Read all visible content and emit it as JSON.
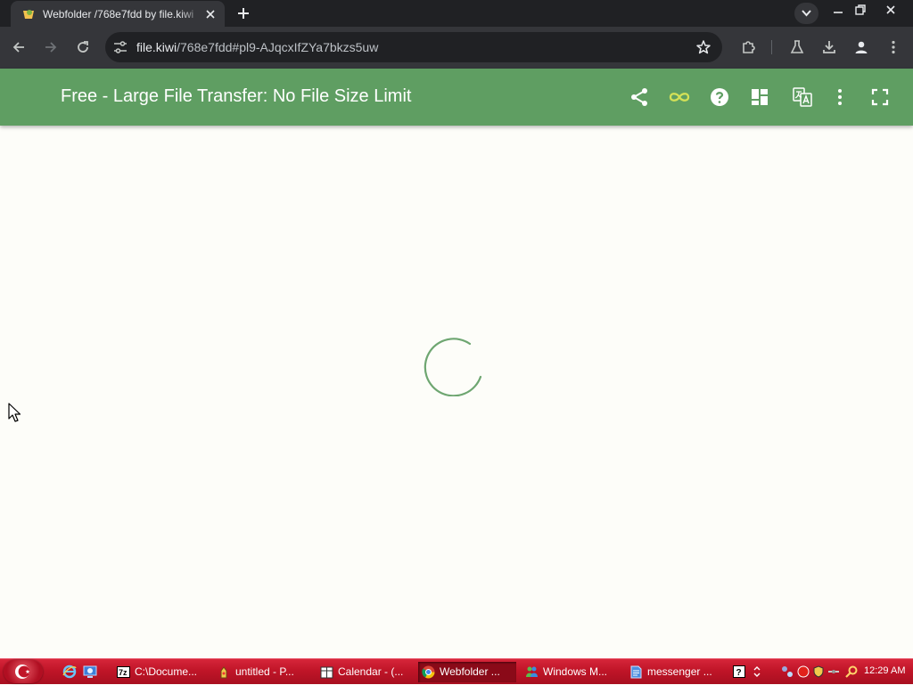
{
  "browser": {
    "tab": {
      "title": "Webfolder /768e7fdd by file.kiwi",
      "favicon": "kiwi-favicon-icon"
    },
    "url": {
      "host": "file.kiwi",
      "path": "/768e7fdd#pl9-AJqcxIfZYa7bkzs5uw"
    },
    "colors": {
      "tabstrip": "#202124",
      "toolbar": "#35363a"
    }
  },
  "app": {
    "title": "Free - Large File Transfer: No File Size Limit",
    "header_color": "#5f9e62",
    "infinity_color": "#d4e157",
    "actions": [
      "share-icon",
      "infinity-icon",
      "help-icon",
      "dashboard-icon",
      "translate-icon",
      "more-vert-icon",
      "fullscreen-icon"
    ],
    "loading": true
  },
  "taskbar": {
    "color": "#c01528",
    "tasks": [
      {
        "label": "C:\\Docume...",
        "icon": "7zip-icon"
      },
      {
        "label": "untitled - P...",
        "icon": "paint-icon"
      },
      {
        "label": "Calendar - (...",
        "icon": "calendar-icon"
      },
      {
        "label": "Webfolder ...",
        "icon": "chrome-icon",
        "active": true
      },
      {
        "label": "Windows M...",
        "icon": "messenger-icon"
      },
      {
        "label": "messenger ...",
        "icon": "document-icon"
      }
    ],
    "clock": "12:29 AM"
  }
}
